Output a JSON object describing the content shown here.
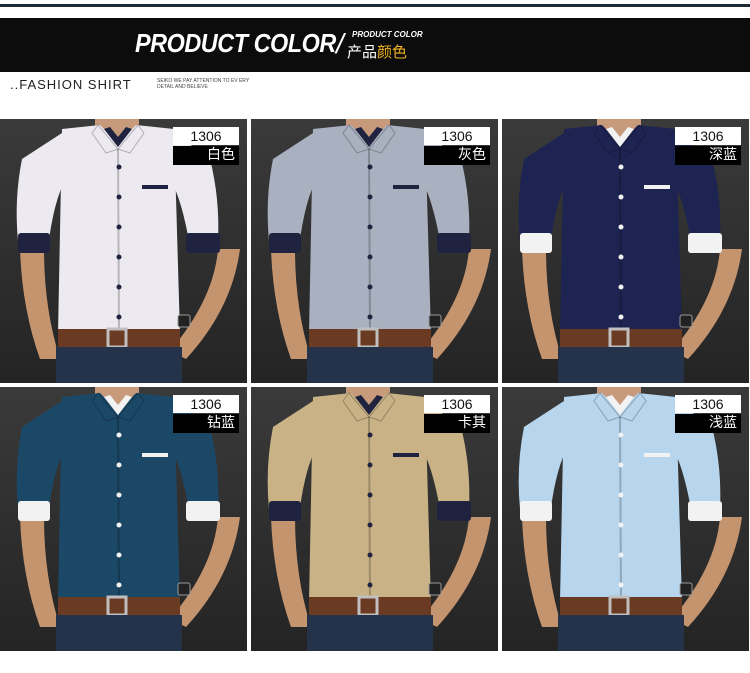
{
  "banner": {
    "title": "PRODUCT COLOR",
    "slash": "/",
    "small_en": "PRODUCT COLOR",
    "cn_part1": "产品",
    "cn_part2": "颜色"
  },
  "subhead": "..FASHION SHIRT",
  "tagline": "SEIKO WE PAY ATTENTION TO EV ERY DETAIL AND BELIEVE",
  "colors": {
    "accent": "#f0b323",
    "banner_bg": "#0c0c0c"
  },
  "products": [
    {
      "code": "1306",
      "name": "白色",
      "shirt": "#eceaf0",
      "cuff": "#1f2340",
      "pocket": "#1f2340"
    },
    {
      "code": "1306",
      "name": "灰色",
      "shirt": "#a9b0bf",
      "cuff": "#1f2340",
      "pocket": "#1f2340"
    },
    {
      "code": "1306",
      "name": "深蓝",
      "shirt": "#1e2452",
      "cuff": "#f2f2f2",
      "pocket": "#f2f2f2"
    },
    {
      "code": "1306",
      "name": "钻蓝",
      "shirt": "#1c4868",
      "cuff": "#f2f2f2",
      "pocket": "#f2f2f2"
    },
    {
      "code": "1306",
      "name": "卡其",
      "shirt": "#c9b286",
      "cuff": "#1f2340",
      "pocket": "#1f2340"
    },
    {
      "code": "1306",
      "name": "浅蓝",
      "shirt": "#b7d6ee",
      "cuff": "#f2f2f2",
      "pocket": "#f2f2f2"
    }
  ]
}
